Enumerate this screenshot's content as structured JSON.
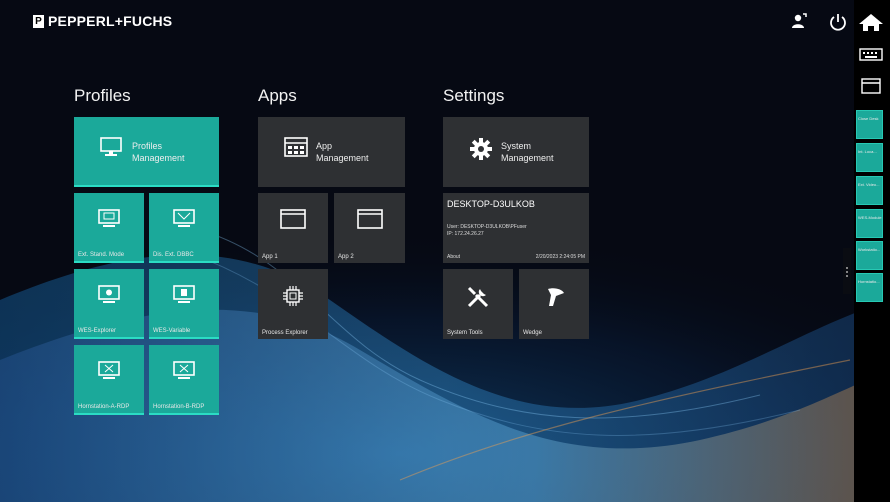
{
  "brand": {
    "name": "PEPPERL+FUCHS"
  },
  "colors": {
    "tile_teal": "#1ba99a",
    "tile_dark": "#2e3033",
    "background": "#060913"
  },
  "header_icons": [
    "user-switch-icon",
    "power-icon"
  ],
  "sections": {
    "profiles": {
      "title": "Profiles",
      "management": "Profiles Management",
      "tiles": [
        "Ext. Stand. Mode",
        "Dis. Ext. DBBC",
        "WES-Explorer",
        "WES-Variable",
        "Hornstation-A-RDP",
        "Hornstation-B-RDP"
      ]
    },
    "apps": {
      "title": "Apps",
      "management": "App Management",
      "tiles": [
        "App 1",
        "App 2",
        "Process Explorer"
      ]
    },
    "settings": {
      "title": "Settings",
      "management": "System Management",
      "info": {
        "hostname": "DESKTOP-D3ULKOB",
        "user": "User: DESKTOP-D3ULKOB\\PFuser",
        "ip": "IP: 172.24.26.27",
        "about": "About",
        "datetime": "2/20/2023 2:24:05 PM"
      },
      "tiles": [
        "System Tools",
        "Wedge"
      ]
    }
  },
  "sidebar": {
    "buttons": [
      "home-icon",
      "keyboard-icon",
      "window-icon"
    ],
    "tiles": [
      "Close Desk",
      "Int. Loca...",
      "Ext. Video...",
      "WES-Module",
      "Workstatio...",
      "Hornstatio..."
    ]
  }
}
